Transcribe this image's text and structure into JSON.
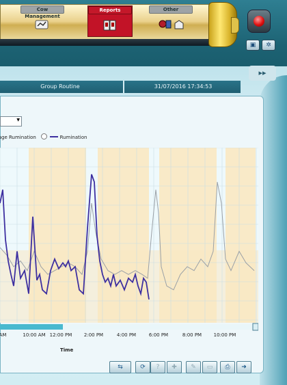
{
  "nav": {
    "tabs": [
      {
        "label": "Cow Management",
        "icon": "cow-management-icon",
        "active": false
      },
      {
        "label": "Reports",
        "icon": "reports-icon",
        "active": true
      },
      {
        "label": "Other",
        "icon": "other-icon",
        "active": false
      }
    ]
  },
  "header": {
    "group": "Group Routine",
    "datetime": "31/07/2016 17:34:53"
  },
  "filter": {
    "selected": ""
  },
  "legend": {
    "items": [
      {
        "label": "Average Rumination",
        "color": "#9aa0a6",
        "checked": true
      },
      {
        "label": "Rumination",
        "color": "#3d2fa0",
        "checked": true
      }
    ]
  },
  "chart_data": {
    "type": "line",
    "xlabel": "Time",
    "x_ticks": [
      "AM",
      "10:00 AM",
      "12:00 PM",
      "2:00 PM",
      "4:00 PM",
      "6:00 PM",
      "8:00 PM",
      "10:00 PM"
    ],
    "series": [
      {
        "name": "Rumination",
        "color": "#3d2fa0",
        "points": [
          [
            0,
            0.55
          ],
          [
            4,
            0.62
          ],
          [
            8,
            0.36
          ],
          [
            12,
            0.25
          ],
          [
            16,
            0.18
          ],
          [
            20,
            0.12
          ],
          [
            25,
            0.3
          ],
          [
            30,
            0.16
          ],
          [
            36,
            0.2
          ],
          [
            42,
            0.08
          ],
          [
            48,
            0.48
          ],
          [
            54,
            0.15
          ],
          [
            58,
            0.18
          ],
          [
            62,
            0.1
          ],
          [
            68,
            0.08
          ],
          [
            74,
            0.2
          ],
          [
            80,
            0.26
          ],
          [
            86,
            0.21
          ],
          [
            92,
            0.24
          ],
          [
            96,
            0.22
          ],
          [
            100,
            0.25
          ],
          [
            104,
            0.2
          ],
          [
            110,
            0.22
          ],
          [
            116,
            0.1
          ],
          [
            122,
            0.08
          ],
          [
            128,
            0.42
          ],
          [
            134,
            0.7
          ],
          [
            138,
            0.66
          ],
          [
            142,
            0.38
          ],
          [
            146,
            0.25
          ],
          [
            150,
            0.18
          ],
          [
            154,
            0.14
          ],
          [
            158,
            0.16
          ],
          [
            162,
            0.12
          ],
          [
            166,
            0.18
          ],
          [
            170,
            0.12
          ],
          [
            176,
            0.15
          ],
          [
            182,
            0.1
          ],
          [
            188,
            0.16
          ],
          [
            194,
            0.14
          ],
          [
            198,
            0.18
          ],
          [
            202,
            0.12
          ],
          [
            206,
            0.08
          ],
          [
            210,
            0.16
          ],
          [
            214,
            0.14
          ],
          [
            218,
            0.05
          ]
        ]
      },
      {
        "name": "Average Rumination",
        "color": "#9aa0a6",
        "points": [
          [
            0,
            0.32
          ],
          [
            10,
            0.28
          ],
          [
            20,
            0.22
          ],
          [
            30,
            0.25
          ],
          [
            40,
            0.2
          ],
          [
            50,
            0.3
          ],
          [
            60,
            0.22
          ],
          [
            70,
            0.18
          ],
          [
            80,
            0.2
          ],
          [
            90,
            0.22
          ],
          [
            100,
            0.24
          ],
          [
            110,
            0.22
          ],
          [
            120,
            0.18
          ],
          [
            128,
            0.3
          ],
          [
            134,
            0.55
          ],
          [
            140,
            0.4
          ],
          [
            148,
            0.26
          ],
          [
            158,
            0.2
          ],
          [
            168,
            0.18
          ],
          [
            178,
            0.2
          ],
          [
            188,
            0.18
          ],
          [
            198,
            0.2
          ],
          [
            208,
            0.18
          ],
          [
            216,
            0.16
          ],
          [
            222,
            0.4
          ],
          [
            228,
            0.62
          ],
          [
            232,
            0.5
          ],
          [
            236,
            0.22
          ],
          [
            244,
            0.12
          ],
          [
            254,
            0.1
          ],
          [
            264,
            0.18
          ],
          [
            274,
            0.22
          ],
          [
            284,
            0.2
          ],
          [
            294,
            0.26
          ],
          [
            304,
            0.22
          ],
          [
            312,
            0.3
          ],
          [
            318,
            0.66
          ],
          [
            324,
            0.55
          ],
          [
            330,
            0.26
          ],
          [
            338,
            0.2
          ],
          [
            350,
            0.3
          ],
          [
            360,
            0.24
          ],
          [
            372,
            0.2
          ]
        ]
      }
    ]
  },
  "toolbar": {
    "buttons": [
      {
        "icon": "export-icon",
        "label": "⇆",
        "enabled": true
      },
      {
        "icon": "refresh-icon",
        "label": "⟳",
        "enabled": true
      },
      {
        "icon": "help-icon",
        "label": "?",
        "enabled": false
      },
      {
        "icon": "add-icon",
        "label": "✚",
        "enabled": false
      },
      {
        "icon": "edit-icon",
        "label": "✎",
        "enabled": false
      },
      {
        "icon": "delete-icon",
        "label": "▭",
        "enabled": false
      },
      {
        "icon": "print-icon",
        "label": "⎙",
        "enabled": true
      },
      {
        "icon": "exit-icon",
        "label": "➜",
        "enabled": true
      }
    ]
  }
}
